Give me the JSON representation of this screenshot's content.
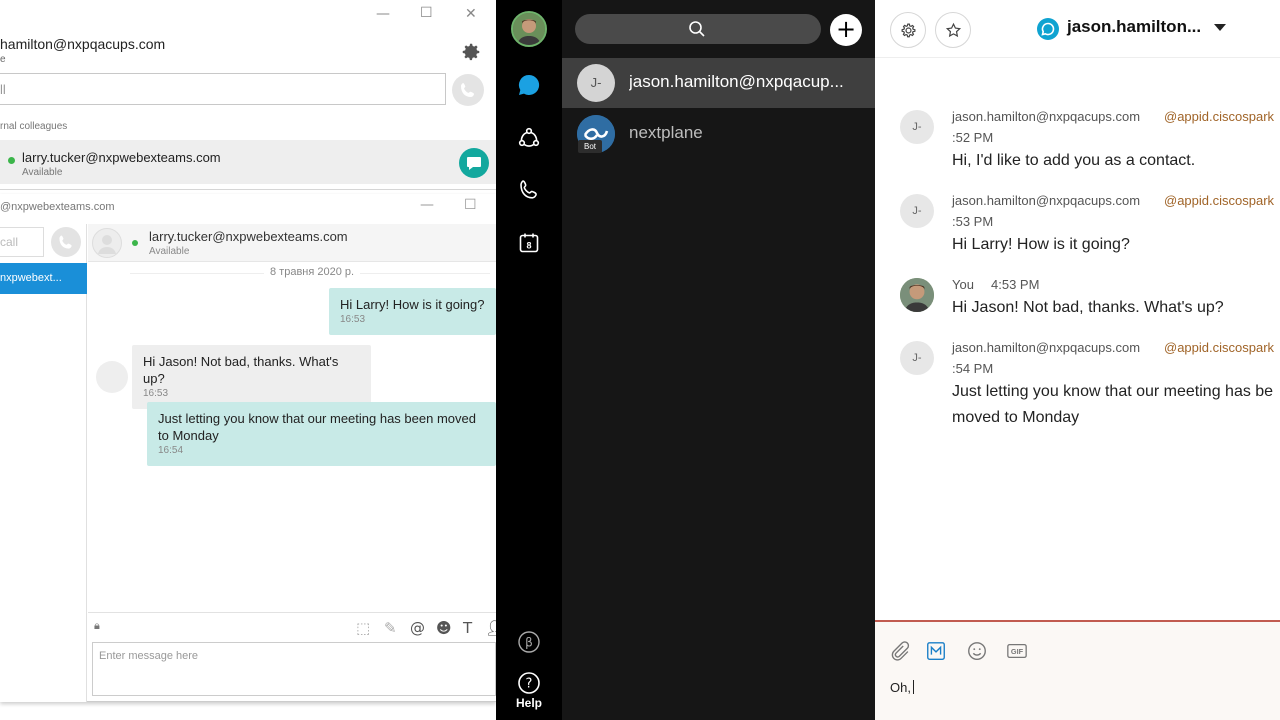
{
  "lync_main": {
    "user": "hamilton@nxpqacups.com",
    "status_fragment": "e",
    "search_placeholder": "ll",
    "group_label": "rnal colleagues",
    "contact_name": "larry.tucker@nxpwebexteams.com",
    "contact_status": "Available"
  },
  "lync_chat": {
    "title": "@nxpwebexteams.com",
    "left_search_placeholder": "call",
    "left_selected": "nxpwebext...",
    "header_name": "larry.tucker@nxpwebexteams.com",
    "header_status": "Available",
    "date": "8 травня 2020 р.",
    "messages": [
      {
        "text": "Hi Larry! How is it going?",
        "time": "16:53"
      },
      {
        "text": "Hi Jason! Not bad, thanks. What's up?",
        "time": "16:53"
      },
      {
        "text": "Just letting you know that our meeting has been moved to Monday",
        "time": "16:54"
      }
    ],
    "input_placeholder": "Enter message here"
  },
  "rail": {
    "help_label": "Help",
    "calendar_day": "8"
  },
  "spaces": {
    "items": [
      {
        "initials": "J-",
        "name": "jason.hamilton@nxpqacup..."
      },
      {
        "initials": "",
        "name": "nextplane",
        "badge": "Bot"
      }
    ]
  },
  "conversation": {
    "title": "jason.hamilton...",
    "messages": [
      {
        "initials": "J-",
        "sender": "jason.hamilton@nxpqacups.com",
        "app": "@appid.ciscospark",
        "time": ":52 PM",
        "text": "Hi, I'd like to add you as a contact."
      },
      {
        "initials": "J-",
        "sender": "jason.hamilton@nxpqacups.com",
        "app": "@appid.ciscospark",
        "time": ":53 PM",
        "text": "Hi Larry! How is it going?"
      },
      {
        "initials": "",
        "sender": "You",
        "app": "",
        "time": "4:53 PM",
        "text": "Hi Jason! Not bad, thanks. What's up?"
      },
      {
        "initials": "J-",
        "sender": "jason.hamilton@nxpqacups.com",
        "app": "@appid.ciscospark",
        "time": ":54 PM",
        "text": "Just letting you know that our meeting has be",
        "text2": "moved to Monday"
      }
    ],
    "composer_text": "Oh,",
    "gif_label": "GIF"
  },
  "colors": {
    "lync_accent": "#1a8fd8",
    "lync_bubble_out": "#c8eae7",
    "lync_chat_button": "#13a89e",
    "webex_rail": "#000000",
    "webex_list": "#161616",
    "webex_space_icon": "#0fa3d1",
    "composer_border": "#c15b50",
    "app_tag": "#a06428"
  }
}
